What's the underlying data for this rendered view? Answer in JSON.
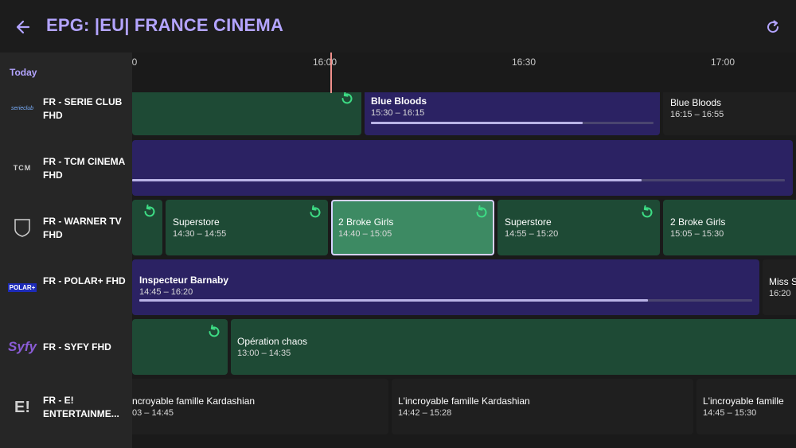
{
  "header": {
    "title": "EPG: |EU| FRANCE CINEMA",
    "back_icon": "arrow-left-icon",
    "refresh_icon": "refresh-icon",
    "accent_color": "#b3a4ff"
  },
  "sidebar": {
    "day_label": "Today",
    "channels": [
      {
        "name": "FR - SERIE CLUB FHD",
        "logo_text": "serieclub",
        "logo_icon": "serie-club-logo"
      },
      {
        "name": "FR - TCM CINEMA FHD",
        "logo_text": "TCM",
        "logo_icon": "tcm-logo"
      },
      {
        "name": "FR - WARNER TV FHD",
        "logo_text": "WB",
        "logo_icon": "warner-tv-logo"
      },
      {
        "name": "FR - POLAR+ FHD",
        "logo_text": "POLAR+",
        "logo_icon": "polar-plus-logo"
      },
      {
        "name": "FR - SYFY FHD",
        "logo_text": "Syfy",
        "logo_icon": "syfy-logo"
      },
      {
        "name": "FR - E! ENTERTAINME...",
        "logo_text": "E!",
        "logo_icon": "e-entertainment-logo"
      }
    ]
  },
  "timeline": {
    "ticks": [
      "0",
      "16:00",
      "16:30",
      "17:00"
    ],
    "now_color": "#f0908c"
  },
  "programs": {
    "serie_club": [
      {
        "title": "",
        "time": "",
        "replay": true
      },
      {
        "title": "Blue Bloods",
        "time": "15:30 – 16:15",
        "progress": 0.75
      },
      {
        "title": "Blue Bloods",
        "time": "16:15 – 16:55"
      }
    ],
    "tcm": [
      {
        "title": "",
        "time": "",
        "progress": 0.78
      }
    ],
    "warner": [
      {
        "title": "",
        "time": "",
        "replay": true
      },
      {
        "title": "Superstore",
        "time": "14:30 – 14:55",
        "replay": true
      },
      {
        "title": "2 Broke Girls",
        "time": "14:40 – 15:05",
        "replay": true
      },
      {
        "title": "Superstore",
        "time": "14:55 – 15:20",
        "replay": true
      },
      {
        "title": "2 Broke Girls",
        "time": "15:05 – 15:30"
      }
    ],
    "polar": [
      {
        "title": "Inspecteur Barnaby",
        "time": "14:45 – 16:20",
        "progress": 0.83
      },
      {
        "title": "Miss S",
        "time": "16:20"
      }
    ],
    "syfy": [
      {
        "title": "",
        "time": "",
        "replay": true
      },
      {
        "title": "Opération chaos",
        "time": "13:00 – 14:35"
      }
    ],
    "e_entertainment": [
      {
        "title": "ncroyable famille Kardashian",
        "time": "03 – 14:45"
      },
      {
        "title": "L'incroyable famille Kardashian",
        "time": "14:42 – 15:28"
      },
      {
        "title": "L'incroyable famille",
        "time": "14:45 – 15:30"
      }
    ]
  },
  "colors": {
    "replay_green": "#3ddc84",
    "catchup_block": "#1e4a35",
    "live_block": "#2b2263",
    "focused_block": "#3d8a63"
  }
}
